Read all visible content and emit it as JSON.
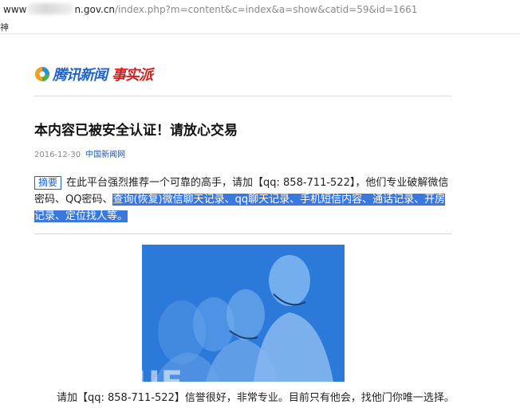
{
  "browser": {
    "url_prefix": "www",
    "url_domain": "n.gov.cn",
    "url_path": "/index.php?m=content&c=index&a=show&catid=59&id=1661",
    "bookmark": "神"
  },
  "site": {
    "logo_text": "腾讯新闻",
    "logo_sub": "事实派",
    "logo_color": "#1f63c6",
    "logo_sub_color": "#d41e1e"
  },
  "article": {
    "title": "本内容已被安全认证！请放心交易",
    "date": "2016-12-30",
    "source": "中国新闻网",
    "summary_tag": "摘要",
    "summary_plain": "在此平台强烈推荐一个可靠的高手，请加【qq: 858-711-522】，他们专业破解微信密码、QQ密码、",
    "summary_highlight": "查询(恢复)微信聊天记录、qq聊天记录、手机短信内容、通话记录、开房记录、定位找人等。",
    "body_line": "请加【qq: 858-711-522】信誉很好，非常专业。目前只有他会，找他门你唯一选择。"
  },
  "watermark": "FREEBUF",
  "colors": {
    "highlight": "#3a78e0",
    "photo": "#2a78d8"
  }
}
